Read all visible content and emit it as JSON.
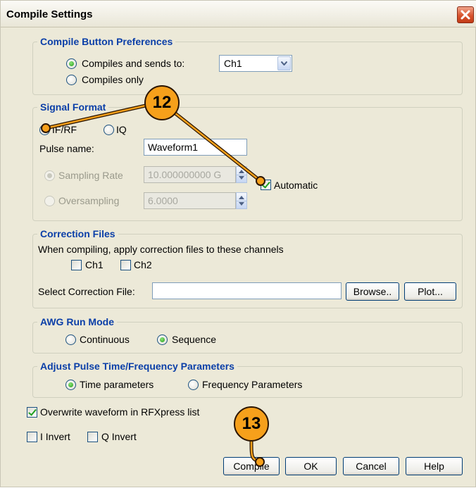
{
  "window": {
    "title": "Compile Settings",
    "close_icon": "close-icon"
  },
  "compile_button_preferences": {
    "legend": "Compile Button Preferences",
    "option_sends": "Compiles and sends to:",
    "option_only": "Compiles only",
    "selected": "Compiles and sends to:",
    "channel_value": "Ch1"
  },
  "signal_format": {
    "legend": "Signal Format",
    "option_ifrf": "IF/RF",
    "option_iq": "IQ",
    "selected": "IF/RF",
    "pulse_name_label": "Pulse name:",
    "pulse_name_value": "Waveform1",
    "sampling_rate_label": "Sampling Rate",
    "sampling_rate_value": "10.000000000 G",
    "oversampling_label": "Oversampling",
    "oversampling_value": "6.0000",
    "automatic_label": "Automatic",
    "automatic_checked": true
  },
  "correction_files": {
    "legend": "Correction Files",
    "description": "When compiling, apply correction files to these channels",
    "ch1_label": "Ch1",
    "ch2_label": "Ch2",
    "select_label": "Select Correction File:",
    "select_value": "",
    "browse_label": "Browse..",
    "plot_label": "Plot..."
  },
  "awg_run_mode": {
    "legend": "AWG Run Mode",
    "option_continuous": "Continuous",
    "option_sequence": "Sequence",
    "selected": "Sequence"
  },
  "adjust_pulse": {
    "legend": "Adjust Pulse Time/Frequency Parameters",
    "option_time": "Time parameters",
    "option_frequency": "Frequency Parameters",
    "selected": "Time parameters"
  },
  "options": {
    "overwrite_label": "Overwrite waveform in RFXpress list",
    "overwrite_checked": true,
    "i_invert_label": "I Invert",
    "q_invert_label": "Q Invert"
  },
  "buttons": {
    "compile": "Compile",
    "ok": "OK",
    "cancel": "Cancel",
    "help": "Help"
  },
  "callouts": {
    "c12": "12",
    "c13": "13",
    "color": "#f6a01b"
  }
}
